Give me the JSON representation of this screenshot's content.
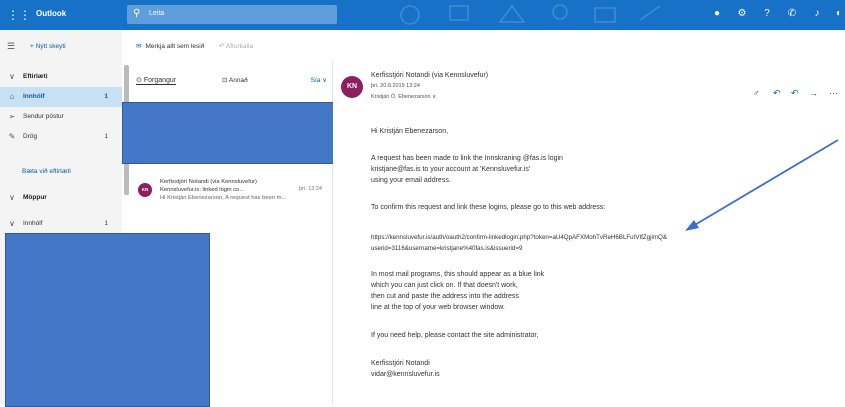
{
  "topbar": {
    "app_name": "Outlook",
    "search_placeholder": "Leita"
  },
  "nav": {
    "new_message": "Nýtt skeyti",
    "favorites_header": "Eftirlæti",
    "inbox": {
      "label": "Innhólf",
      "count": "1"
    },
    "sent": {
      "label": "Sendur póstur"
    },
    "drafts": {
      "label": "Drög",
      "count": "1"
    },
    "add_favorite": "Bæta við eftirlæti",
    "folders_header": "Möppur",
    "inbox2": {
      "label": "Innhólf",
      "count": "1"
    }
  },
  "commands": {
    "mark_all_read": "Merkja allt sem lesið",
    "undo": "Afturkalla"
  },
  "list": {
    "tab_focused": "Forgangur",
    "tab_other": "Annað",
    "filter": "Sía",
    "message": {
      "avatar": "KN",
      "sender": "Kerfisstjóri Notandi (via Kennsluvefur)",
      "subject": "Kennsluvefur.is: linked login co...",
      "time": "þri. 13:24",
      "preview": "Hi Kristján Ebenezarson, A request has been m..."
    }
  },
  "reading": {
    "avatar": "KN",
    "from": "Kerfisstjóri Notandi (via Kennsluvefur)",
    "date": "þri. 20.8.2019 13:24",
    "to": "Kristján Ö. Ebenezarson ∨",
    "body": [
      "Hi Kristján Ebenezarson,",
      "A request has been made to link the Innskraning @fas.is login",
      "kristjane@fas.is to your account at 'Kennsluvefur.is'",
      "using your email address.",
      "To confirm this request and link these logins, please go to this web address:",
      "https://kennsluvefur.is/auth/oauth2/confirm-linkedlogin.php?token=aU4QpAFXMohTvReH6BLFutVIfZgjimQ&",
      "userid=3116&username=kristjane%40fas.is&issuerid=9",
      "In most mail programs, this should appear as a blue link",
      "which you can just click on. If that doesn't work,",
      "then cut and paste the address into the address",
      "line at the top of your web browser window.",
      "If you need help, please contact the site administrator,",
      "Kerfisstjóri Notandi",
      "vidar@kennsluvefur.is"
    ]
  },
  "colors": {
    "topbar": "#1772c7",
    "accent": "#0b5cab",
    "redaction": "#4478c6",
    "avatar": "#8b1f5f"
  },
  "icons": [
    "waffle-icon",
    "search-icon",
    "skype-icon",
    "settings-icon",
    "help-icon",
    "megaphone-icon",
    "reply-icon",
    "reply-all-icon",
    "forward-icon"
  ]
}
